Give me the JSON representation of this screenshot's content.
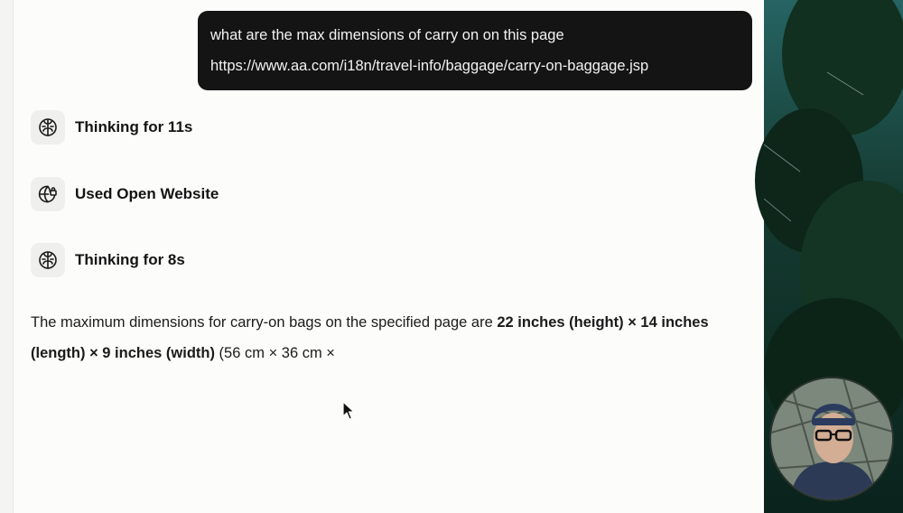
{
  "user_message": {
    "text": "what are the max dimensions of carry on on this page",
    "url": "https://www.aa.com/i18n/travel-info/baggage/carry-on-baggage.jsp"
  },
  "steps": [
    {
      "icon": "brain-icon",
      "label": "Thinking for 11s"
    },
    {
      "icon": "globe-lock-icon",
      "label": "Used Open Website"
    },
    {
      "icon": "brain-icon",
      "label": "Thinking for 8s"
    }
  ],
  "answer": {
    "prefix": "The maximum dimensions for carry-on bags on the specified page are ",
    "bold": "22 inches (height) × 14 inches (length) × 9 inches (width)",
    "suffix": " (56 cm × 36 cm ×"
  },
  "colors": {
    "bubble_bg": "#141414",
    "chat_bg": "#fcfcfb",
    "icon_box_bg": "#efefee"
  }
}
